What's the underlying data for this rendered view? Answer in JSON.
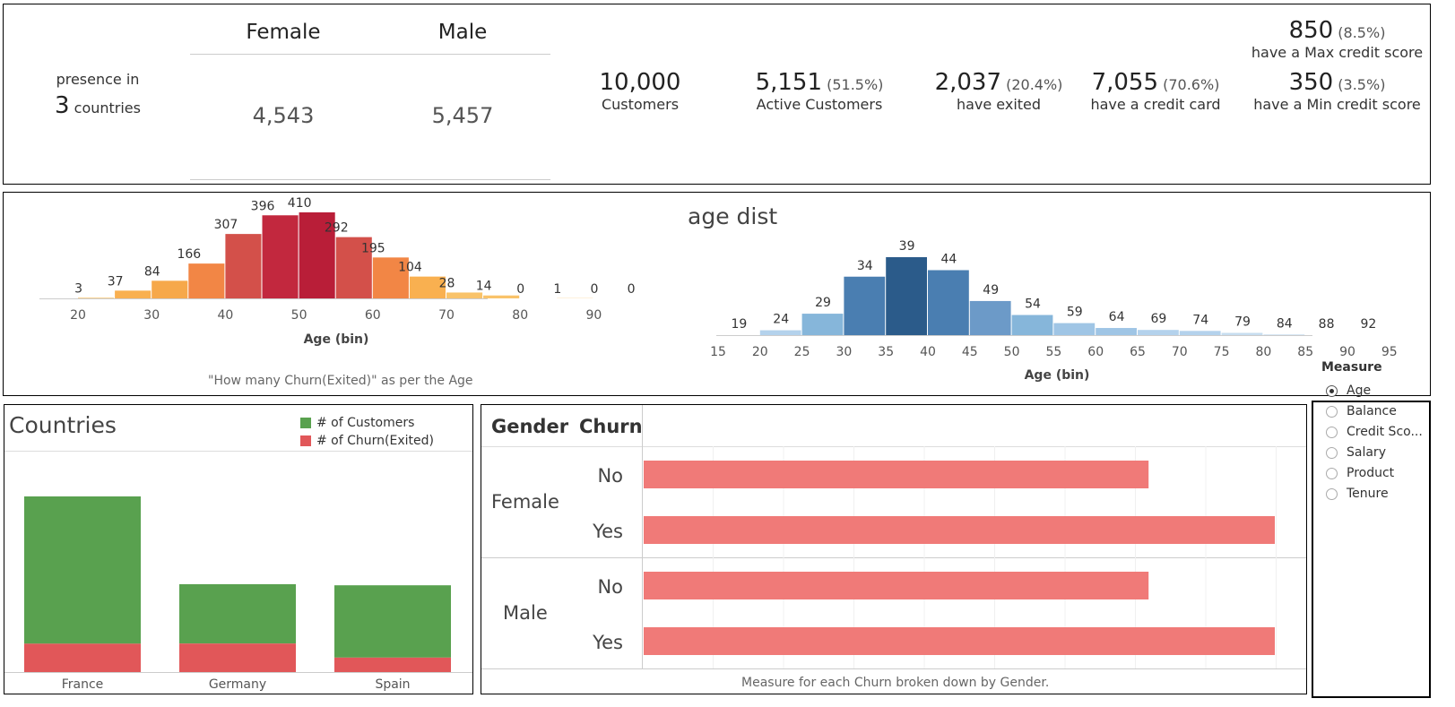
{
  "kpi": {
    "presence_label": "presence in",
    "countries_count": "3",
    "countries_label": "countries",
    "female_header": "Female",
    "male_header": "Male",
    "female_value": "4,543",
    "male_value": "5,457",
    "customers_value": "10,000",
    "customers_label": "Customers",
    "active_value": "5,151",
    "active_pct": "(51.5%)",
    "active_label": "Active Customers",
    "exited_value": "2,037",
    "exited_pct": "(20.4%)",
    "exited_label": "have exited",
    "card_value": "7,055",
    "card_pct": "(70.6%)",
    "card_label": "have a credit card",
    "max_value": "850",
    "max_pct": "(8.5%)",
    "max_label": "have a Max credit score",
    "min_value": "350",
    "min_pct": "(3.5%)",
    "min_label": "have a Min credit score"
  },
  "age_panel": {
    "title": "age dist",
    "caption": "\"How many Churn(Exited)\"  as per the Age"
  },
  "countries_panel": {
    "title": "Countries",
    "legend_customers": "# of Customers",
    "legend_churn": "# of Churn(Exited)"
  },
  "gender_panel": {
    "header_gender": "Gender",
    "header_churn": "Churn",
    "caption": "Measure for each Churn broken down by Gender."
  },
  "measure": {
    "title": "Measure",
    "options": [
      "Age",
      "Balance",
      "Credit Sco...",
      "Salary",
      "Product",
      "Tenure"
    ],
    "selected": "Age"
  },
  "colors": {
    "customers_green": "#59a14f",
    "churn_red": "#e15759",
    "bar_salmon": "#f07a78"
  },
  "chart_data": [
    {
      "type": "bar",
      "name": "churn_by_age",
      "xlabel": "Age (bin)",
      "bin_starts": [
        20,
        25,
        30,
        35,
        40,
        45,
        50,
        55,
        60,
        65,
        70,
        75,
        80,
        85,
        90,
        95
      ],
      "values": [
        3,
        37,
        84,
        166,
        307,
        396,
        410,
        292,
        195,
        104,
        28,
        14,
        0,
        1,
        0,
        0
      ],
      "x_ticks": [
        20,
        30,
        40,
        50,
        60,
        70,
        80,
        90
      ],
      "colors": [
        "#f9c36a",
        "#f9b050",
        "#f6a84a",
        "#f28645",
        "#d3504a",
        "#c2283e",
        "#b91e38",
        "#d3504a",
        "#f28645",
        "#f9b050",
        "#f9c36a",
        "#f9c36a",
        "#f9c36a",
        "#f9c36a",
        "#f9c36a",
        "#f9c36a"
      ]
    },
    {
      "type": "bar",
      "name": "age_dist",
      "xlabel": "Age (bin)",
      "bin_starts": [
        15,
        20,
        25,
        30,
        35,
        40,
        45,
        50,
        55,
        60,
        65,
        70,
        75,
        80,
        85,
        90
      ],
      "values": [
        19,
        24,
        29,
        34,
        39,
        44,
        49,
        54,
        59,
        64,
        69,
        74,
        79,
        84,
        88,
        92
      ],
      "heights": [
        0,
        1.5,
        6.6,
        18,
        24,
        20,
        10.5,
        6.2,
        3.7,
        2.2,
        1.6,
        1.3,
        0.7,
        0.2,
        0,
        0
      ],
      "x_ticks": [
        15,
        20,
        25,
        30,
        35,
        40,
        45,
        50,
        55,
        60,
        65,
        70,
        75,
        80,
        85,
        90,
        95
      ],
      "colors": [
        "#c7ddef",
        "#b4d2ec",
        "#86b6da",
        "#4a7eb1",
        "#2b5b8a",
        "#4a7eb1",
        "#6c9ac8",
        "#86b6da",
        "#9fc5e5",
        "#9fc5e5",
        "#b4d2ec",
        "#b4d2ec",
        "#c7ddef",
        "#c7ddef",
        "#c7ddef",
        "#c7ddef"
      ]
    },
    {
      "type": "bar",
      "name": "countries",
      "categories": [
        "France",
        "Germany",
        "Spain"
      ],
      "series": [
        {
          "name": "# of Customers",
          "values": [
            5014,
            2509,
            2477
          ]
        },
        {
          "name": "# of Churn(Exited)",
          "values": [
            810,
            814,
            413
          ]
        }
      ]
    },
    {
      "type": "bar",
      "name": "gender_churn",
      "rows": [
        {
          "gender": "Female",
          "churn": "No",
          "value": 0.8
        },
        {
          "gender": "Female",
          "churn": "Yes",
          "value": 1.0
        },
        {
          "gender": "Male",
          "churn": "No",
          "value": 0.8
        },
        {
          "gender": "Male",
          "churn": "Yes",
          "value": 1.0
        }
      ]
    }
  ]
}
